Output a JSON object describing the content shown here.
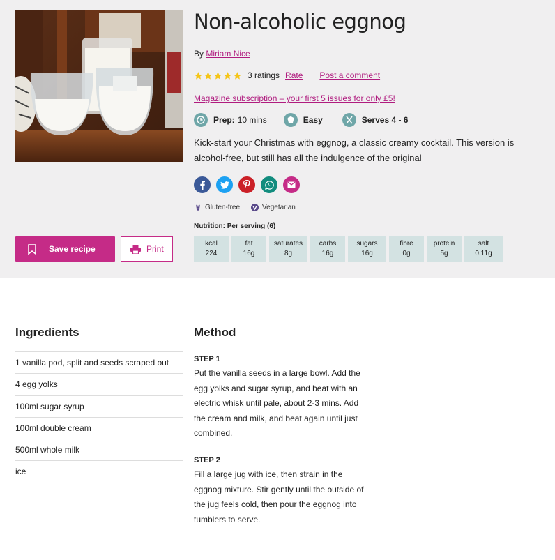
{
  "recipe": {
    "title": "Non-alcoholic eggnog",
    "byline_prefix": "By",
    "author": "Miriam Nice",
    "rating_count": "3 ratings",
    "rate_label": "Rate",
    "comment_label": "Post a comment",
    "stars": 5,
    "promo": "Magazine subscription – your first 5 issues for only £5!",
    "prep_label": "Prep:",
    "prep_value": "10 mins",
    "difficulty": "Easy",
    "serves": "Serves 4 - 6",
    "description": "Kick-start your Christmas with eggnog, a classic creamy cocktail. This version is alcohol-free, but still has all the indulgence of the original",
    "diet": [
      "Gluten-free",
      "Vegetarian"
    ]
  },
  "colors": {
    "accent": "#c52b87",
    "link": "#b01c7f",
    "star": "#f5c518",
    "meta_icon": "#6fa6a8",
    "nutrition_bg": "#d3e2e2",
    "facebook": "#3b5998",
    "twitter": "#1da1f2",
    "pinterest": "#cb2027",
    "whatsapp": "#128c7e",
    "email": "#c52b87"
  },
  "social": [
    "facebook-icon",
    "twitter-icon",
    "pinterest-icon",
    "whatsapp-icon",
    "email-icon"
  ],
  "nutrition": {
    "title": "Nutrition: Per serving (6)",
    "items": [
      {
        "label": "kcal",
        "value": "224"
      },
      {
        "label": "fat",
        "value": "16g"
      },
      {
        "label": "saturates",
        "value": "8g"
      },
      {
        "label": "carbs",
        "value": "16g"
      },
      {
        "label": "sugars",
        "value": "16g"
      },
      {
        "label": "fibre",
        "value": "0g"
      },
      {
        "label": "protein",
        "value": "5g"
      },
      {
        "label": "salt",
        "value": "0.11g"
      }
    ]
  },
  "actions": {
    "save_label": "Save recipe",
    "print_label": "Print"
  },
  "ingredients": {
    "heading": "Ingredients",
    "items": [
      "1 vanilla pod, split and seeds scraped out",
      "4 egg yolks",
      "100ml sugar syrup",
      "100ml double cream",
      "500ml whole milk",
      "ice"
    ]
  },
  "method": {
    "heading": "Method",
    "steps": [
      {
        "label": "STEP 1",
        "text": "Put the vanilla seeds in a large bowl. Add the egg yolks and sugar syrup, and beat with an electric whisk until pale, about 2-3 mins. Add the cream and milk, and beat again until just combined."
      },
      {
        "label": "STEP 2",
        "text": "Fill a large jug with ice, then strain in the eggnog mixture. Stir gently until the outside of the jug feels cold, then pour the eggnog into tumblers to serve."
      }
    ]
  }
}
